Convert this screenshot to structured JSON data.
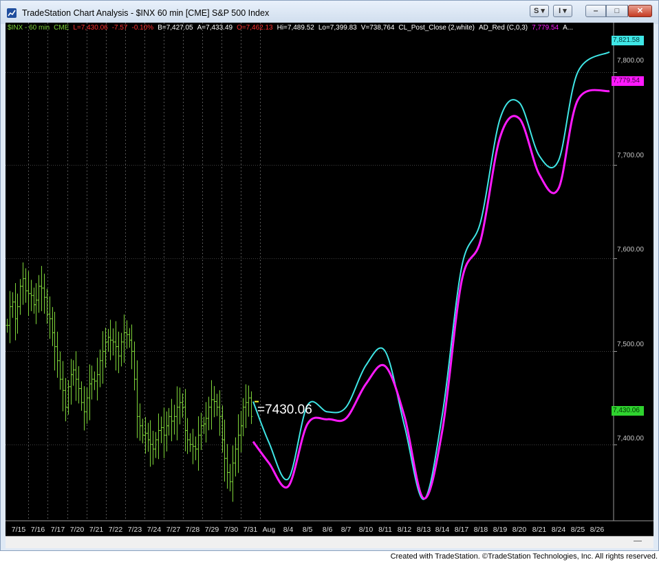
{
  "window": {
    "title": "TradeStation Chart Analysis - $INX 60 min [CME] S&P 500 Index",
    "buttons": {
      "s": "S ▾",
      "i": "I ▾",
      "minimize": "‒",
      "maximize": "□",
      "close": "✕"
    }
  },
  "legend": {
    "symbol": "$INX - 60 min",
    "exchange": "CME",
    "last": "L=7,430.06",
    "change": "-7.57",
    "change_pct": "-0.10%",
    "bid": "B=7,427.05",
    "ask": "A=7,433.49",
    "open": "O=7,462.13",
    "high": "Hi=7,489.52",
    "low": "Lo=7,399.83",
    "volume": "V=738,764",
    "study1": "CL_Post_Close (2,white)",
    "study2": "AD_Red (C,0,3)",
    "study2_value": "7,779.54",
    "study3": "A..."
  },
  "price_tags": {
    "cyan": "7,821.58",
    "magenta": "7,779.54",
    "last": "7,430.06"
  },
  "callout": "=7430.06",
  "footer": "Created with TradeStation. ©TradeStation Technologies, Inc. All rights reserved.",
  "colors": {
    "background": "#000000",
    "bars": "#7fd63a",
    "cyan_line": "#3fe6e6",
    "magenta_line": "#ff1aff",
    "grid": "#444444",
    "down_text": "#ff3030",
    "up_text": "#7fd63a"
  },
  "chart_data": {
    "type": "line",
    "y_axis": {
      "ticks": [
        "7,400.00",
        "7,500.00",
        "7,600.00",
        "7,700.00",
        "7,800.00"
      ],
      "tick_values": [
        7400,
        7500,
        7600,
        7700,
        7800
      ],
      "ylim": [
        7318,
        7853
      ],
      "grid": true
    },
    "x_axis": {
      "labels": [
        "7/15",
        "7/16",
        "7/17",
        "7/20",
        "7/21",
        "7/22",
        "7/23",
        "7/24",
        "7/27",
        "7/28",
        "7/29",
        "7/30",
        "7/31",
        "Aug",
        "8/4",
        "8/5",
        "8/6",
        "8/7",
        "8/10",
        "8/11",
        "8/12",
        "8/13",
        "8/14",
        "8/17",
        "8/18",
        "8/19",
        "8/20",
        "8/21",
        "8/24",
        "8/25",
        "8/26"
      ]
    },
    "price_bars": {
      "name": "$INX",
      "closes": [
        7528,
        7548,
        7553,
        7535,
        7548,
        7570,
        7578,
        7565,
        7562,
        7560,
        7550,
        7555,
        7570,
        7568,
        7558,
        7540,
        7535,
        7520,
        7505,
        7490,
        7470,
        7458,
        7440,
        7462,
        7475,
        7480,
        7470,
        7460,
        7445,
        7435,
        7450,
        7465,
        7470,
        7468,
        7475,
        7490,
        7500,
        7510,
        7515,
        7512,
        7510,
        7505,
        7495,
        7510,
        7520,
        7518,
        7512,
        7500,
        7470,
        7430,
        7420,
        7410,
        7412,
        7405,
        7400,
        7395,
        7405,
        7415,
        7418,
        7410,
        7420,
        7430,
        7425,
        7430,
        7440,
        7445,
        7440,
        7415,
        7405,
        7400,
        7398,
        7395,
        7410,
        7420,
        7422,
        7428,
        7440,
        7448,
        7446,
        7440,
        7430,
        7405,
        7385,
        7370,
        7360,
        7380,
        7395,
        7410,
        7420,
        7440,
        7445,
        7450,
        7430
      ],
      "last": 7430.06
    },
    "series": [
      {
        "color": "#3fe6e6",
        "x": [
          "7/31",
          "Aug",
          "8/4",
          "8/5",
          "8/6",
          "8/7",
          "8/10",
          "8/11",
          "8/12",
          "8/13",
          "8/14",
          "8/17",
          "8/18",
          "8/19",
          "8/20",
          "8/21",
          "8/24",
          "8/25",
          "8/26"
        ],
        "values": [
          7446,
          7402,
          7363,
          7442,
          7435,
          7440,
          7485,
          7500,
          7420,
          7341,
          7432,
          7590,
          7640,
          7750,
          7767,
          7710,
          7705,
          7800,
          7821.58
        ]
      },
      {
        "color": "#ff1aff",
        "x": [
          "7/31",
          "Aug",
          "8/4",
          "8/5",
          "8/6",
          "8/7",
          "8/10",
          "8/11",
          "8/12",
          "8/13",
          "8/14",
          "8/17",
          "8/18",
          "8/19",
          "8/20",
          "8/21",
          "8/24",
          "8/25",
          "8/26"
        ],
        "values": [
          7403,
          7380,
          7355,
          7422,
          7427,
          7428,
          7465,
          7484,
          7430,
          7342,
          7415,
          7575,
          7620,
          7730,
          7750,
          7690,
          7675,
          7770,
          7779.54
        ]
      }
    ]
  }
}
